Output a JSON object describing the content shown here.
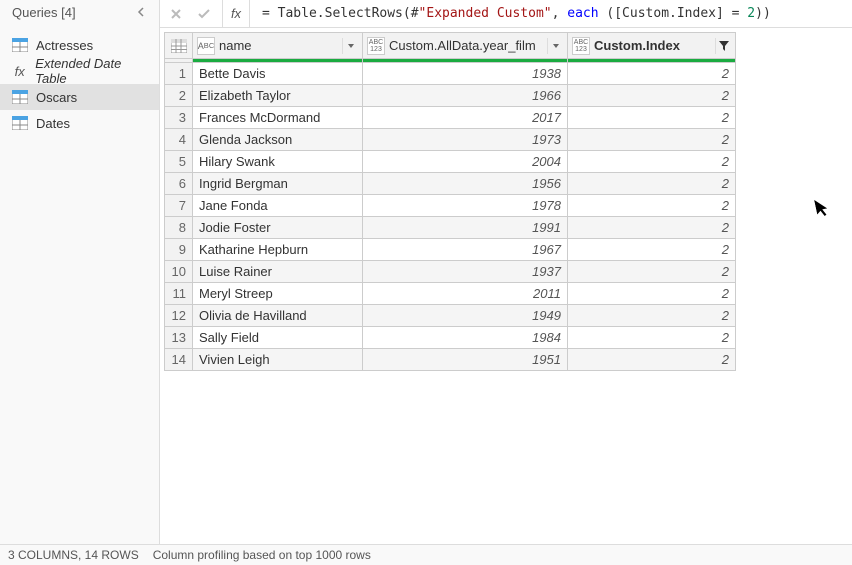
{
  "sidebar": {
    "title": "Queries [4]",
    "items": [
      {
        "label": "Actresses",
        "icon": "table"
      },
      {
        "label": "Extended Date Table",
        "icon": "fx"
      },
      {
        "label": "Oscars",
        "icon": "table",
        "selected": true
      },
      {
        "label": "Dates",
        "icon": "table"
      }
    ]
  },
  "formula": {
    "prefix": "= ",
    "fn": "Table.SelectRows",
    "open": "(#",
    "str": "\"Expanded Custom\"",
    "mid": ", ",
    "kw": "each",
    "rest1": " ([Custom.Index] = ",
    "num": "2",
    "rest2": "))"
  },
  "columns": [
    {
      "type": "ABC",
      "label": "name"
    },
    {
      "type": "ABC123",
      "label": "Custom.AllData.year_film"
    },
    {
      "type": "ABC123",
      "label": "Custom.Index",
      "filtered": true
    }
  ],
  "rows": [
    {
      "n": "1",
      "name": "Bette Davis",
      "year": "1938",
      "idx": "2"
    },
    {
      "n": "2",
      "name": "Elizabeth Taylor",
      "year": "1966",
      "idx": "2"
    },
    {
      "n": "3",
      "name": "Frances McDormand",
      "year": "2017",
      "idx": "2"
    },
    {
      "n": "4",
      "name": "Glenda Jackson",
      "year": "1973",
      "idx": "2"
    },
    {
      "n": "5",
      "name": "Hilary Swank",
      "year": "2004",
      "idx": "2"
    },
    {
      "n": "6",
      "name": "Ingrid Bergman",
      "year": "1956",
      "idx": "2"
    },
    {
      "n": "7",
      "name": "Jane Fonda",
      "year": "1978",
      "idx": "2"
    },
    {
      "n": "8",
      "name": "Jodie Foster",
      "year": "1991",
      "idx": "2"
    },
    {
      "n": "9",
      "name": "Katharine Hepburn",
      "year": "1967",
      "idx": "2"
    },
    {
      "n": "10",
      "name": "Luise Rainer",
      "year": "1937",
      "idx": "2"
    },
    {
      "n": "11",
      "name": "Meryl Streep",
      "year": "2011",
      "idx": "2"
    },
    {
      "n": "12",
      "name": "Olivia de Havilland",
      "year": "1949",
      "idx": "2"
    },
    {
      "n": "13",
      "name": "Sally Field",
      "year": "1984",
      "idx": "2"
    },
    {
      "n": "14",
      "name": "Vivien Leigh",
      "year": "1951",
      "idx": "2"
    }
  ],
  "status": {
    "counts": "3 COLUMNS, 14 ROWS",
    "profiling": "Column profiling based on top 1000 rows"
  }
}
